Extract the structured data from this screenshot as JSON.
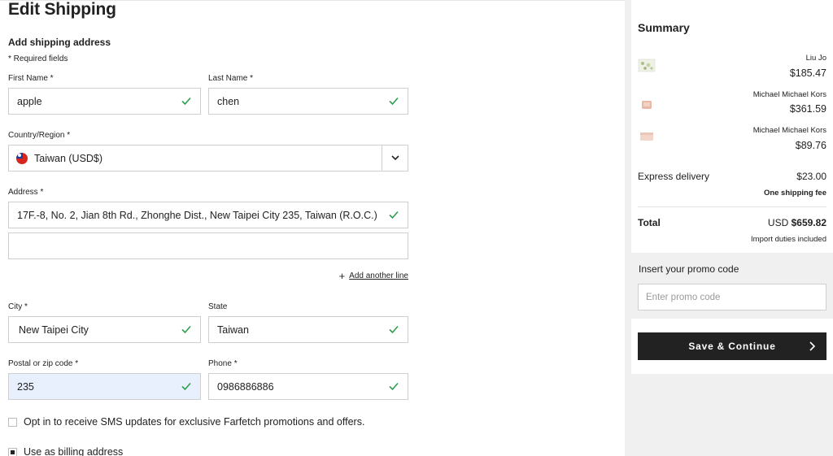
{
  "form": {
    "title": "Edit Shipping",
    "subtitle": "Add shipping address",
    "required_note": "* Required fields",
    "first_name": {
      "label": "First Name *",
      "value": "apple"
    },
    "last_name": {
      "label": "Last Name *",
      "value": "chen"
    },
    "country": {
      "label": "Country/Region *",
      "value": "Taiwan (USD$)"
    },
    "address": {
      "label": "Address *",
      "value": "17F.-8, No. 2, Jian 8th Rd., Zhonghe Dist., New Taipei City 235, Taiwan (R.O.C.)",
      "line2": ""
    },
    "add_line": "Add another line",
    "city": {
      "label": "City *",
      "value": "New Taipei City"
    },
    "state": {
      "label": "State",
      "value": "Taiwan"
    },
    "postal": {
      "label": "Postal or zip code *",
      "value": "235"
    },
    "phone": {
      "label": "Phone *",
      "value": "0986886886"
    },
    "sms_optin": "Opt in to receive SMS updates for exclusive Farfetch promotions and offers.",
    "billing": "Use as billing address"
  },
  "summary": {
    "title": "Summary",
    "items": [
      {
        "brand": "Liu Jo",
        "price": "$185.47"
      },
      {
        "brand": "Michael Michael Kors",
        "price": "$361.59"
      },
      {
        "brand": "Michael Michael Kors",
        "price": "$89.76"
      }
    ],
    "delivery_label": "Express delivery",
    "delivery_price": "$23.00",
    "shipping_fee_note": "One shipping fee",
    "total_label": "Total",
    "total_currency": "USD",
    "total_value": "$659.82",
    "duties_note": "Import duties included",
    "promo_label": "Insert your promo code",
    "promo_placeholder": "Enter promo code",
    "save_button": "Save & Continue"
  },
  "colors": {
    "accent_check": "#2e9e4f",
    "button_bg": "#222222",
    "autofill_bg": "#e8f0fe"
  }
}
